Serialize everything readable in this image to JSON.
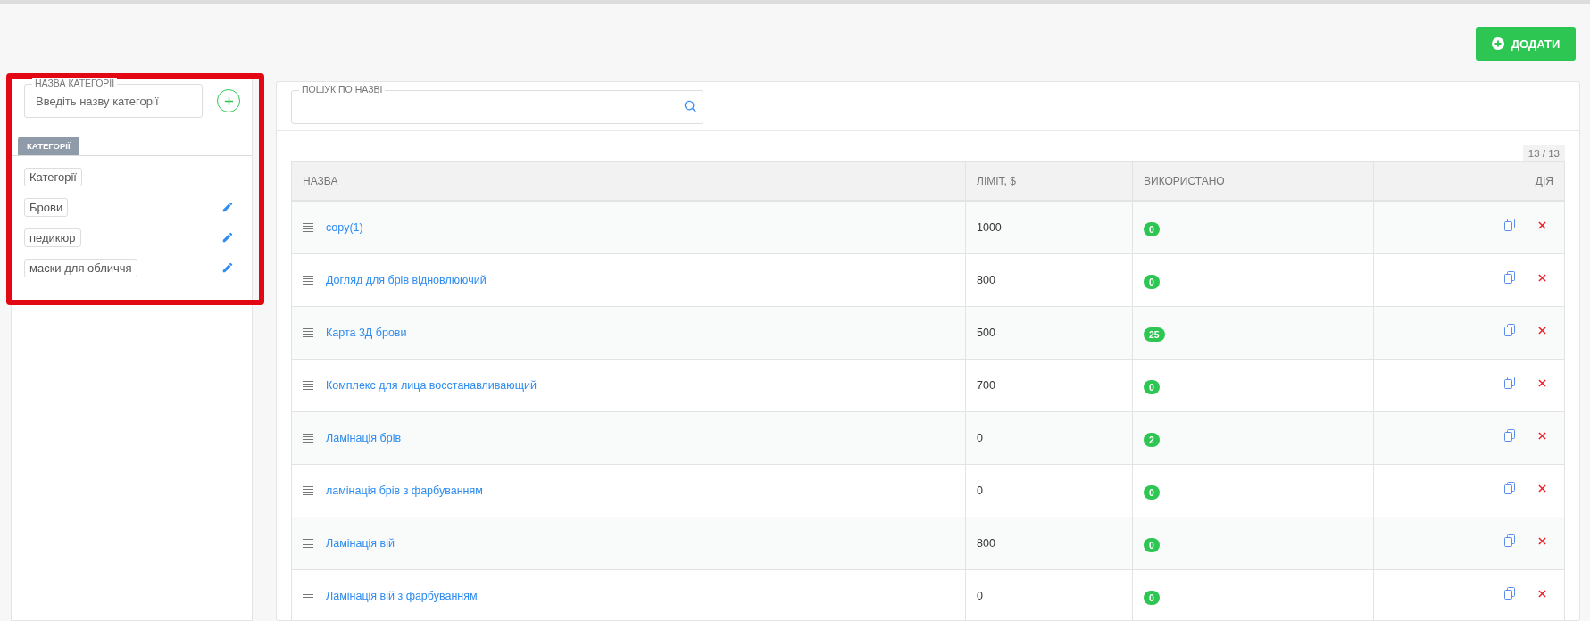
{
  "add_button": {
    "label": "ДОДАТИ"
  },
  "category_panel": {
    "name_field": {
      "label": "НАЗВА КАТЕГОРІЇ",
      "placeholder": "Введіть назву категорії"
    },
    "tab": {
      "label": "КАТЕГОРІЇ",
      "selected": true
    },
    "categories": [
      {
        "label": "Категорії",
        "editable": false
      },
      {
        "label": "Брови",
        "editable": true
      },
      {
        "label": "педикюр",
        "editable": true
      },
      {
        "label": "маски для обличчя",
        "editable": true
      }
    ]
  },
  "search": {
    "label": "ПОШУК ПО НАЗВІ"
  },
  "counter": "13 / 13",
  "table": {
    "columns": [
      "НАЗВА",
      "ЛІМІТ, $",
      "ВИКОРИСТАНО",
      "ДІЯ"
    ],
    "rows": [
      {
        "name": "copy(1)",
        "limit": "1000",
        "used": "0"
      },
      {
        "name": "Догляд для брів відновлюючий",
        "limit": "800",
        "used": "0"
      },
      {
        "name": "Карта 3Д брови",
        "limit": "500",
        "used": "25"
      },
      {
        "name": "Комплекс для лица восстанавливающий",
        "limit": "700",
        "used": "0"
      },
      {
        "name": "Ламінація брів",
        "limit": "0",
        "used": "2"
      },
      {
        "name": "ламінація брів з фарбуванням",
        "limit": "0",
        "used": "0"
      },
      {
        "name": "Ламінація вій",
        "limit": "800",
        "used": "0"
      },
      {
        "name": "Ламінація вій з фарбуванням",
        "limit": "0",
        "used": "0"
      }
    ]
  }
}
